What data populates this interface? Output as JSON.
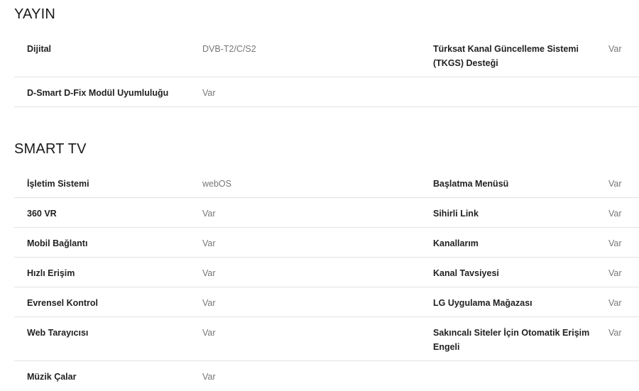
{
  "sections": [
    {
      "title": "YAYIN",
      "rows": [
        {
          "l_label": "Dijital",
          "l_value": "DVB-T2/C/S2",
          "r_label": "Türksat Kanal Güncelleme Sistemi (TKGS) Desteği",
          "r_value": "Var"
        },
        {
          "l_label": "D-Smart D-Fix Modül Uyumluluğu",
          "l_value": "Var",
          "r_label": "",
          "r_value": ""
        }
      ]
    },
    {
      "title": "SMART TV",
      "rows": [
        {
          "l_label": "İşletim Sistemi",
          "l_value": "webOS",
          "r_label": "Başlatma Menüsü",
          "r_value": "Var"
        },
        {
          "l_label": "360 VR",
          "l_value": "Var",
          "r_label": "Sihirli Link",
          "r_value": "Var"
        },
        {
          "l_label": "Mobil Bağlantı",
          "l_value": "Var",
          "r_label": "Kanallarım",
          "r_value": "Var"
        },
        {
          "l_label": "Hızlı Erişim",
          "l_value": "Var",
          "r_label": "Kanal Tavsiyesi",
          "r_value": "Var"
        },
        {
          "l_label": "Evrensel Kontrol",
          "l_value": "Var",
          "r_label": "LG Uygulama Mağazası",
          "r_value": "Var"
        },
        {
          "l_label": "Web Tarayıcısı",
          "l_value": "Var",
          "r_label": "Sakıncalı Siteler İçin Otomatik Erişim Engeli",
          "r_value": "Var"
        },
        {
          "l_label": "Müzik Çalar",
          "l_value": "Var",
          "r_label": "",
          "r_value": ""
        }
      ]
    }
  ]
}
